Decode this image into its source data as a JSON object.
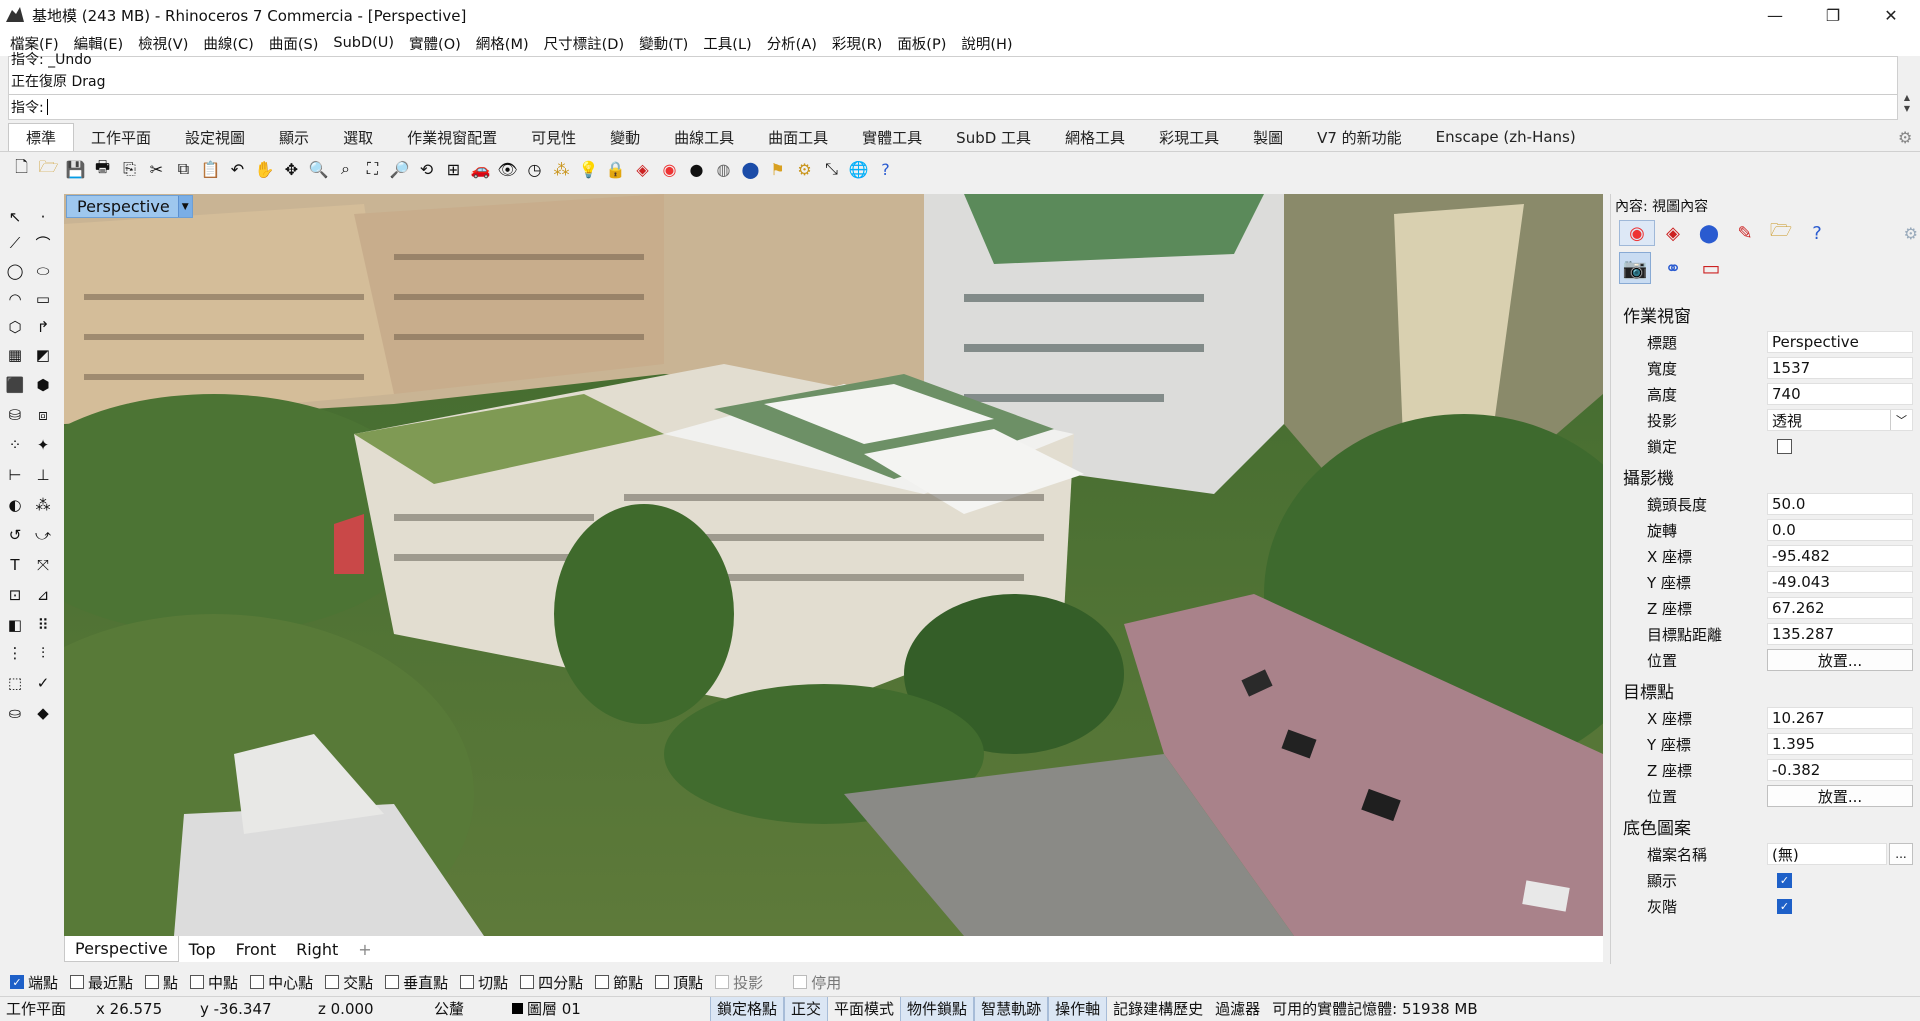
{
  "window": {
    "title": "基地模 (243 MB) - Rhinoceros 7 Commercia - [Perspective]",
    "minimize": "—",
    "restore": "❐",
    "close": "✕"
  },
  "menu": [
    "檔案(F)",
    "編輯(E)",
    "檢視(V)",
    "曲線(C)",
    "曲面(S)",
    "SubD(U)",
    "實體(O)",
    "網格(M)",
    "尺寸標註(D)",
    "變動(T)",
    "工具(L)",
    "分析(A)",
    "彩現(R)",
    "面板(P)",
    "說明(H)"
  ],
  "command": {
    "history": [
      "指令: _Undo",
      "正在復原 Drag"
    ],
    "prompt": "指令:"
  },
  "tabs": [
    "標準",
    "工作平面",
    "設定視圖",
    "顯示",
    "選取",
    "作業視窗配置",
    "可見性",
    "變動",
    "曲線工具",
    "曲面工具",
    "實體工具",
    "SubD 工具",
    "網格工具",
    "彩現工具",
    "製圖",
    "V7 的新功能",
    "Enscape (zh-Hans)"
  ],
  "active_tab": "標準",
  "viewport": {
    "label": "Perspective",
    "tabs": [
      "Perspective",
      "Top",
      "Front",
      "Right"
    ],
    "add_tab": "+"
  },
  "osnap": [
    {
      "label": "端點",
      "checked": true
    },
    {
      "label": "最近點",
      "checked": false
    },
    {
      "label": "點",
      "checked": false
    },
    {
      "label": "中點",
      "checked": false
    },
    {
      "label": "中心點",
      "checked": false
    },
    {
      "label": "交點",
      "checked": false
    },
    {
      "label": "垂直點",
      "checked": false
    },
    {
      "label": "切點",
      "checked": false
    },
    {
      "label": "四分點",
      "checked": false
    },
    {
      "label": "節點",
      "checked": false
    },
    {
      "label": "頂點",
      "checked": false
    },
    {
      "label": "投影",
      "checked": false,
      "disabled": true
    },
    {
      "label": "停用",
      "checked": false,
      "disabled": true
    }
  ],
  "status": {
    "cplane": "工作平面",
    "x": "x 26.575",
    "y": "y -36.347",
    "z": "z 0.000",
    "unit": "公釐",
    "layer": "圖層 01",
    "grid_snap": "鎖定格點",
    "ortho": "正交",
    "planar": "平面模式",
    "osnap": "物件鎖點",
    "smarttrack": "智慧軌跡",
    "gumball": "操作軸",
    "history": "記錄建構歷史",
    "filter": "過濾器",
    "memory": "可用的實體記憶體: 51938 MB"
  },
  "panel": {
    "title": "內容: 視圖內容",
    "viewport_section": "作業視窗",
    "camera_section": "攝影機",
    "target_section": "目標點",
    "wallpaper_section": "底色圖案",
    "title_label": "標題",
    "title_value": "Perspective",
    "width_label": "寬度",
    "width_value": "1537",
    "height_label": "高度",
    "height_value": "740",
    "projection_label": "投影",
    "projection_value": "透視",
    "locked_label": "鎖定",
    "lens_label": "鏡頭長度",
    "lens_value": "50.0",
    "rotation_label": "旋轉",
    "rotation_value": "0.0",
    "cx_label": "X 座標",
    "cx_value": "-95.482",
    "cy_label": "Y 座標",
    "cy_value": "-49.043",
    "cz_label": "Z 座標",
    "cz_value": "67.262",
    "dist_label": "目標點距離",
    "dist_value": "135.287",
    "cam_pos_label": "位置",
    "place_button": "放置...",
    "tx_label": "X 座標",
    "tx_value": "10.267",
    "ty_label": "Y 座標",
    "ty_value": "1.395",
    "tz_label": "Z 座標",
    "tz_value": "-0.382",
    "tgt_pos_label": "位置",
    "file_label": "檔案名稱",
    "file_value": "(無)",
    "browse": "...",
    "show_label": "顯示",
    "gray_label": "灰階"
  }
}
